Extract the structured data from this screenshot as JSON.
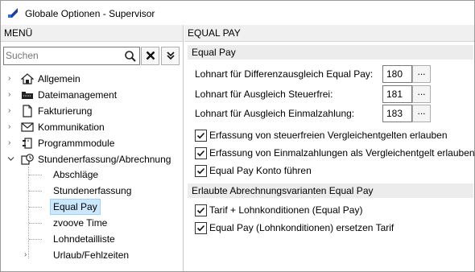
{
  "window": {
    "title": "Globale Optionen - Supervisor"
  },
  "left_pane": {
    "header": "MENÜ",
    "search": {
      "value": "",
      "placeholder": "Suchen"
    },
    "tree": [
      {
        "label": "Allgemein",
        "icon": "home-icon"
      },
      {
        "label": "Dateimanagement",
        "icon": "folder-icon"
      },
      {
        "label": "Fakturierung",
        "icon": "document-icon"
      },
      {
        "label": "Kommunikation",
        "icon": "envelope-icon"
      },
      {
        "label": "Programmmodule",
        "icon": "plugin-icon"
      },
      {
        "label": "Stundenerfassung/Abrechnung",
        "icon": "clock-icon",
        "expanded": true,
        "children": [
          {
            "label": "Abschläge"
          },
          {
            "label": "Stundenerfassung"
          },
          {
            "label": "Equal Pay",
            "selected": true
          },
          {
            "label": "zvoove Time"
          },
          {
            "label": "Lohndetailliste"
          },
          {
            "label": "Urlaub/Fehlzeiten"
          }
        ]
      }
    ]
  },
  "right_pane": {
    "header": "EQUAL PAY",
    "section1": {
      "title": "Equal Pay",
      "fields": [
        {
          "label": "Lohnart für Differenzausgleich Equal Pay:",
          "value": "180",
          "button": "..."
        },
        {
          "label": "Lohnart für Ausgleich Steuerfrei:",
          "value": "181",
          "button": "..."
        },
        {
          "label": "Lohnart für Ausgleich Einmalzahlung:",
          "value": "183",
          "button": "..."
        }
      ],
      "checkboxes": [
        {
          "label": "Erfassung von steuerfreien Vergleichentgelten erlauben",
          "checked": true
        },
        {
          "label": "Erfassung von Einmalzahlungen als Vergleichentgelt erlauben",
          "checked": true
        },
        {
          "label": "Equal Pay Konto führen",
          "checked": true
        }
      ]
    },
    "section2": {
      "title": "Erlaubte Abrechnungsvarianten Equal Pay",
      "checkboxes": [
        {
          "label": "Tarif + Lohnkonditionen (Equal Pay)",
          "checked": true
        },
        {
          "label": "Equal Pay (Lohnkonditionen) ersetzen Tarif",
          "checked": true
        }
      ]
    }
  },
  "colors": {
    "selection_bg": "#cce8ff",
    "header_bg": "#f0f0f0",
    "app_icon": "#1f3f99"
  }
}
